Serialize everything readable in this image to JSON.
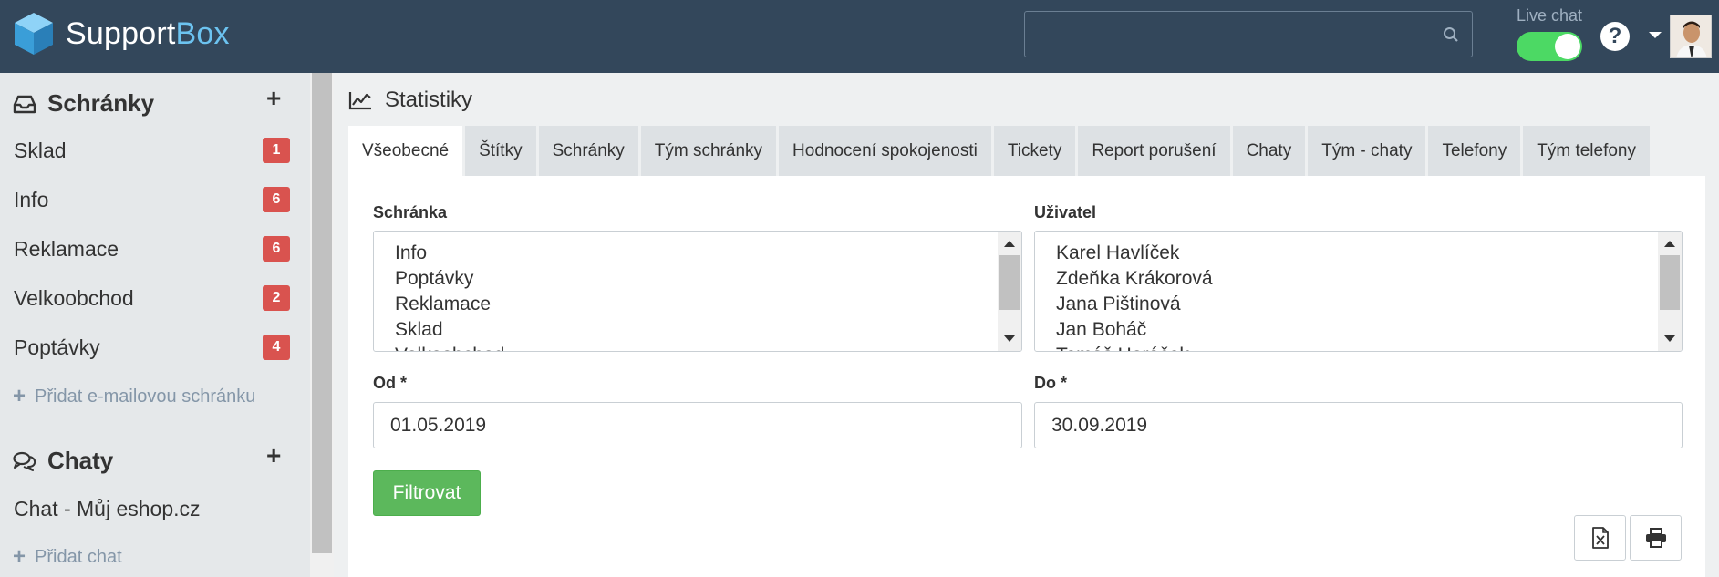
{
  "app": {
    "logo_text": "Support",
    "logo_accent": "Box",
    "search": {
      "value": "",
      "placeholder": ""
    },
    "live_chat_label": "Live chat",
    "live_chat_on": true,
    "help_glyph": "?"
  },
  "sidebar": {
    "mailboxes_title": "Schránky",
    "mailboxes": [
      {
        "label": "Sklad",
        "count": "1"
      },
      {
        "label": "Info",
        "count": "6"
      },
      {
        "label": "Reklamace",
        "count": "6"
      },
      {
        "label": "Velkoobchod",
        "count": "2"
      },
      {
        "label": "Poptávky",
        "count": "4"
      }
    ],
    "add_mailbox_label": "Přidat e-mailovou schránku",
    "chats_title": "Chaty",
    "chats": [
      {
        "label": "Chat - Můj eshop.cz"
      }
    ],
    "add_chat_label": "Přidat chat",
    "plus_glyph": "+"
  },
  "main": {
    "title": "Statistiky",
    "tabs": [
      {
        "label": "Všeobecné",
        "active": true
      },
      {
        "label": "Štítky"
      },
      {
        "label": "Schránky"
      },
      {
        "label": "Tým schránky"
      },
      {
        "label": "Hodnocení spokojenosti"
      },
      {
        "label": "Tickety"
      },
      {
        "label": "Report porušení"
      },
      {
        "label": "Chaty"
      },
      {
        "label": "Tým - chaty"
      },
      {
        "label": "Telefony"
      },
      {
        "label": "Tým telefony"
      }
    ],
    "mailbox_label": "Schránka",
    "mailbox_options": [
      "Info",
      "Poptávky",
      "Reklamace",
      "Sklad",
      "Velkoobchod"
    ],
    "user_label": "Uživatel",
    "user_options": [
      "Karel Havlíček",
      "Zdeňka Krákorová",
      "Jana Pištinová",
      "Jan Boháč",
      "Tomáš Horáček"
    ],
    "from_label": "Od *",
    "from_value": "01.05.2019",
    "to_label": "Do *",
    "to_value": "30.09.2019",
    "filter_label": "Filtrovat"
  },
  "colors": {
    "topbar": "#33475b",
    "accent": "#6cc3f0",
    "badge": "#d9534f",
    "filter_button": "#5cb85c",
    "toggle_on": "#4cd964"
  }
}
